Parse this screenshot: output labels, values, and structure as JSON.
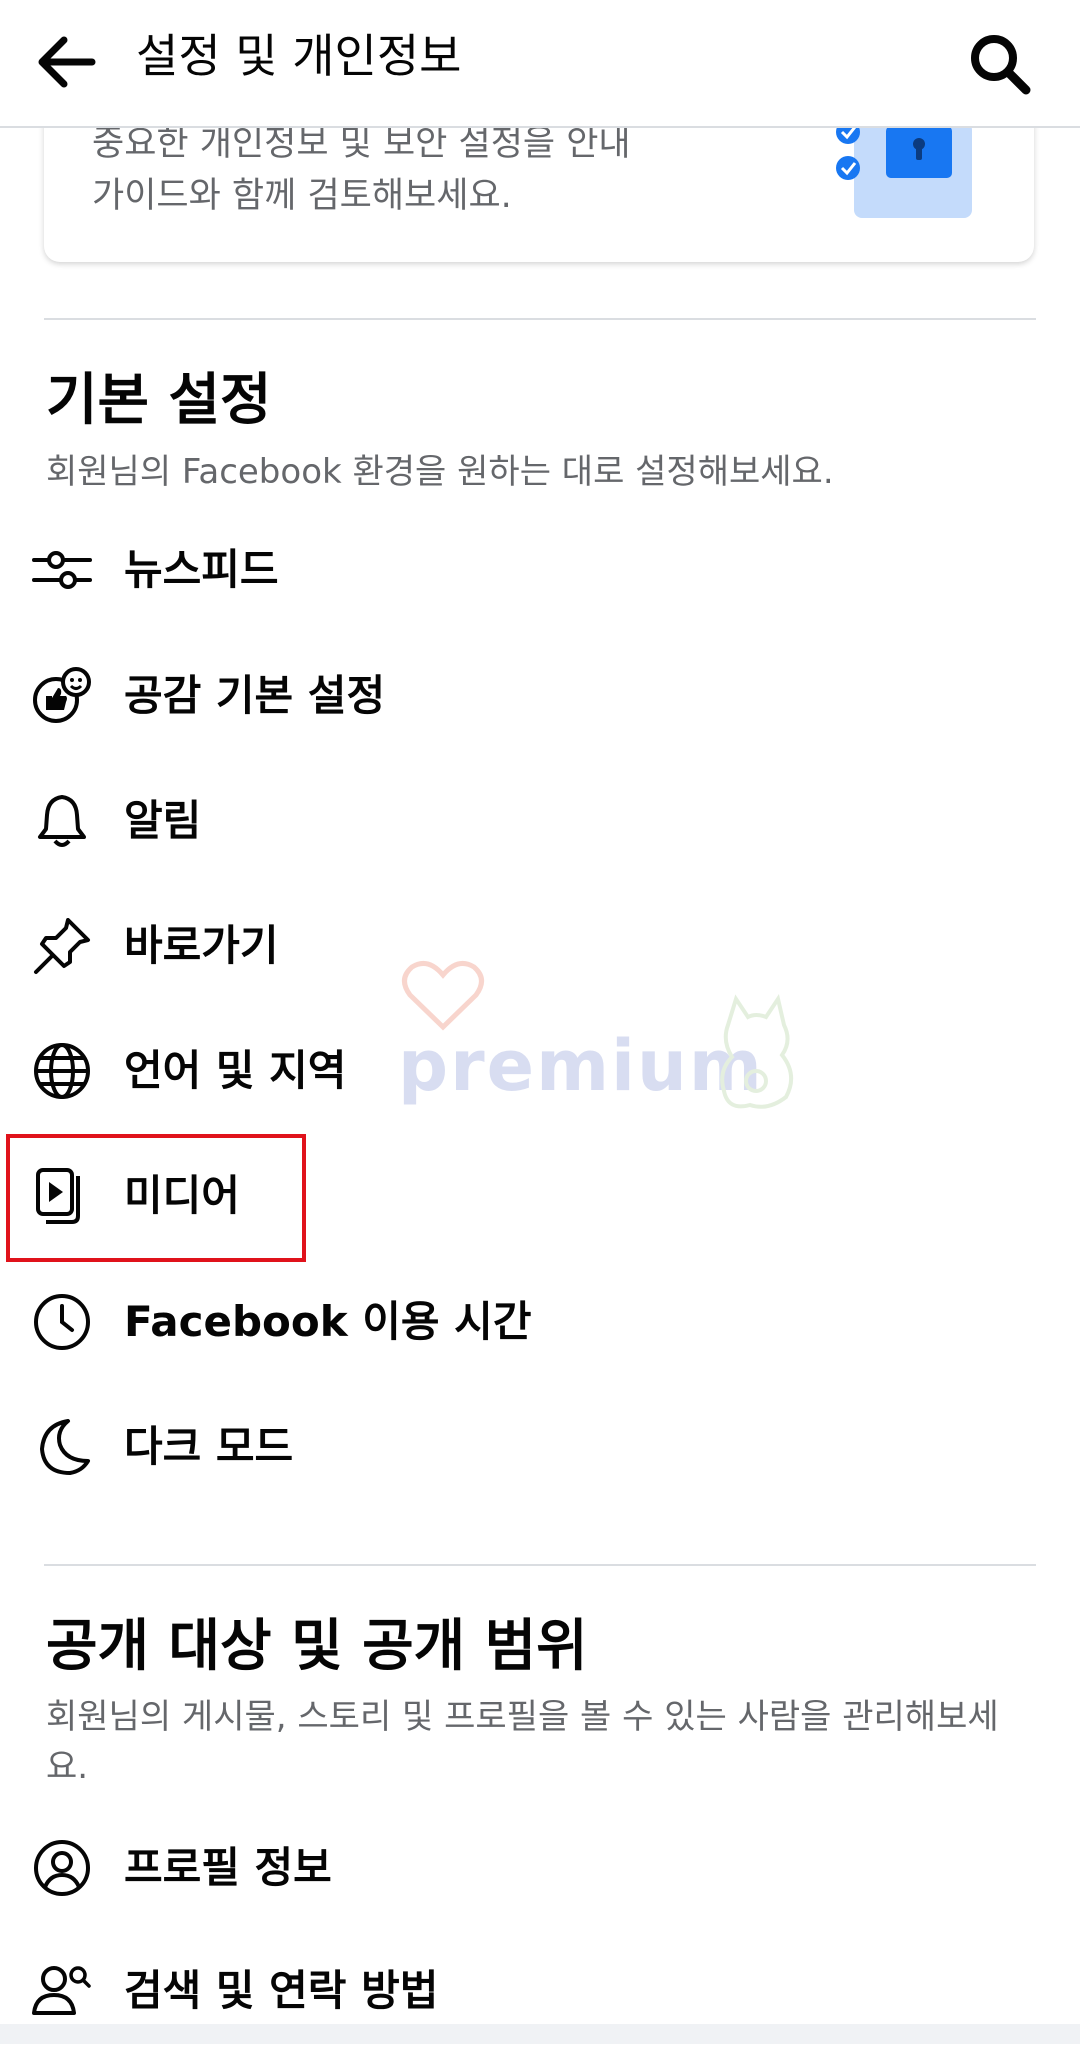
{
  "appbar": {
    "title": "설정 및 개인정보",
    "back_icon": "arrow-left-icon",
    "search_icon": "search-icon"
  },
  "privacy_card": {
    "text_line1": "중요한 개인정보 및 보안 설정을 안내",
    "text_line2": "가이드와 함께 검토해보세요."
  },
  "basic_settings": {
    "title": "기본 설정",
    "description": "회원님의 Facebook 환경을 원하는 대로 설정해보세요.",
    "items": [
      {
        "label": "뉴스피드",
        "icon": "sliders-icon"
      },
      {
        "label": "공감 기본 설정",
        "icon": "reactions-icon"
      },
      {
        "label": "알림",
        "icon": "bell-icon"
      },
      {
        "label": "바로가기",
        "icon": "pin-icon"
      },
      {
        "label": "언어 및 지역",
        "icon": "globe-icon"
      },
      {
        "label": "미디어",
        "icon": "media-icon"
      },
      {
        "label": "Facebook 이용 시간",
        "icon": "clock-icon"
      },
      {
        "label": "다크 모드",
        "icon": "moon-icon"
      }
    ]
  },
  "audience": {
    "title": "공개 대상 및 공개 범위",
    "description": "회원님의 게시물, 스토리 및 프로필을 볼 수 있는 사람을 관리해보세요.",
    "items": [
      {
        "label": "프로필 정보",
        "icon": "profile-icon"
      },
      {
        "label": "검색 및 연락 방법",
        "icon": "people-search-icon"
      }
    ]
  },
  "watermark": {
    "text": "premium"
  },
  "colors": {
    "highlight": "#e0121b",
    "secondary_text": "#65676b",
    "divider": "#dadde1",
    "accent": "#1877f2"
  }
}
